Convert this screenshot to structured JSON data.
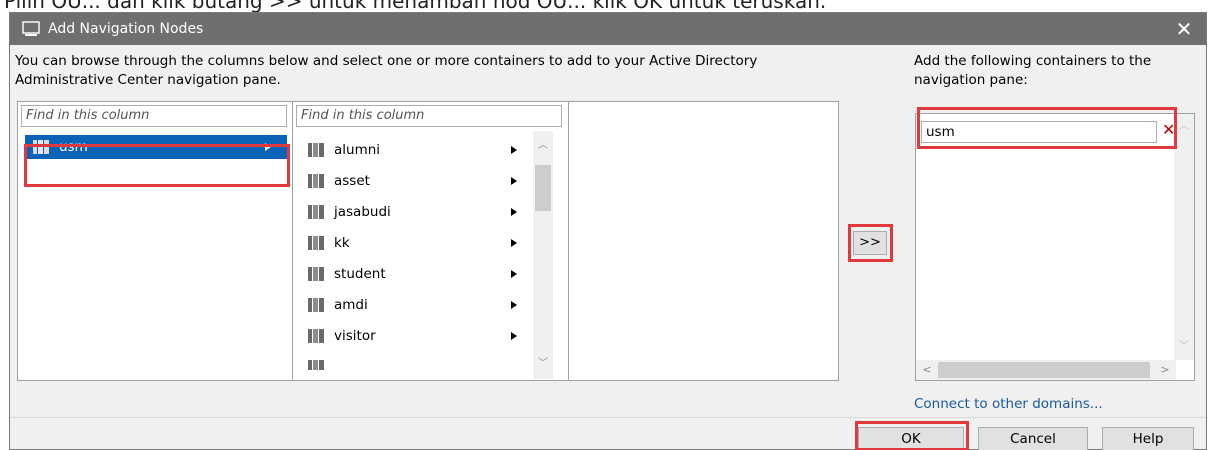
{
  "caption": "Pilih OU... dan klik butang >> untuk menambah nod OU... klik OK untuk teruskan.",
  "dialog": {
    "title": "Add Navigation Nodes",
    "close_label": "✕"
  },
  "description": "You can browse through the columns below and select one or more containers to add to your Active Directory Administrative Center navigation pane.",
  "right_description": "Add the following containers to the navigation pane:",
  "columns": {
    "find_placeholder": "Find in this column",
    "col1_items": [
      {
        "label": "usm",
        "selected": true
      }
    ],
    "col2_items": [
      {
        "label": "alumni"
      },
      {
        "label": "asset"
      },
      {
        "label": "jasabudi"
      },
      {
        "label": "kk"
      },
      {
        "label": "student"
      },
      {
        "label": "amdi"
      },
      {
        "label": "visitor"
      }
    ]
  },
  "add_button_label": ">>",
  "target": {
    "items": [
      {
        "label": "usm",
        "remove_label": "✕"
      }
    ]
  },
  "connect_link": "Connect to other domains...",
  "buttons": {
    "ok": "OK",
    "cancel": "Cancel",
    "help": "Help"
  },
  "colors": {
    "highlight": "#e0393e",
    "selection": "#0a63b7",
    "titlebar": "#6f6f6f",
    "link": "#1a5a9a"
  }
}
